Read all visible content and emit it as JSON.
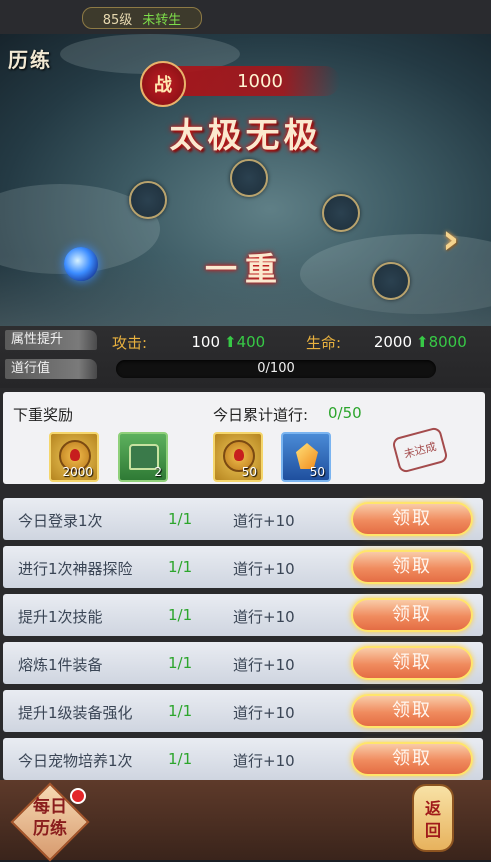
{
  "topbar": {
    "level": "85级",
    "rebirth": "未转生"
  },
  "scene": {
    "tag": "历练",
    "power_label": "战",
    "power_value": "1000",
    "realm_title": "太极无极",
    "stage_label": "一重",
    "next_arrow": "›"
  },
  "attributes": {
    "tab_attr": "属性提升",
    "attack_label": "攻击:",
    "attack_value": "100",
    "attack_bonus": "400",
    "hp_label": "生命:",
    "hp_value": "2000",
    "hp_bonus": "8000",
    "tab_dao": "道行值",
    "dao_progress_text": "0/100",
    "dao_progress": 0.0
  },
  "rewards": {
    "title": "下重奖励",
    "today_label": "今日累计道行:",
    "today_value": "0/50",
    "items": [
      {
        "icon": "gold-coin-icon",
        "count": "2000"
      },
      {
        "icon": "green-chest-icon",
        "count": "2"
      },
      {
        "icon": "gold-coin-icon",
        "count": "50"
      },
      {
        "icon": "orange-gem-icon",
        "count": "50"
      }
    ],
    "stamp": "未达成"
  },
  "tasks": [
    {
      "name": "今日登录1次",
      "progress": "1/1",
      "reward": "道行+10",
      "button": "领取"
    },
    {
      "name": "进行1次神器探险",
      "progress": "1/1",
      "reward": "道行+10",
      "button": "领取"
    },
    {
      "name": "提升1次技能",
      "progress": "1/1",
      "reward": "道行+10",
      "button": "领取"
    },
    {
      "name": "熔炼1件装备",
      "progress": "1/1",
      "reward": "道行+10",
      "button": "领取"
    },
    {
      "name": "提升1级装备强化",
      "progress": "1/1",
      "reward": "道行+10",
      "button": "领取"
    },
    {
      "name": "今日宠物培养1次",
      "progress": "1/1",
      "reward": "道行+10",
      "button": "领取"
    }
  ],
  "bottom": {
    "daily_line1": "每日",
    "daily_line2": "历练",
    "return_line1": "返",
    "return_line2": "回"
  },
  "colors": {
    "accent_gold": "#e8b13f",
    "bonus_green": "#37c946",
    "power_red": "#c21d24"
  }
}
